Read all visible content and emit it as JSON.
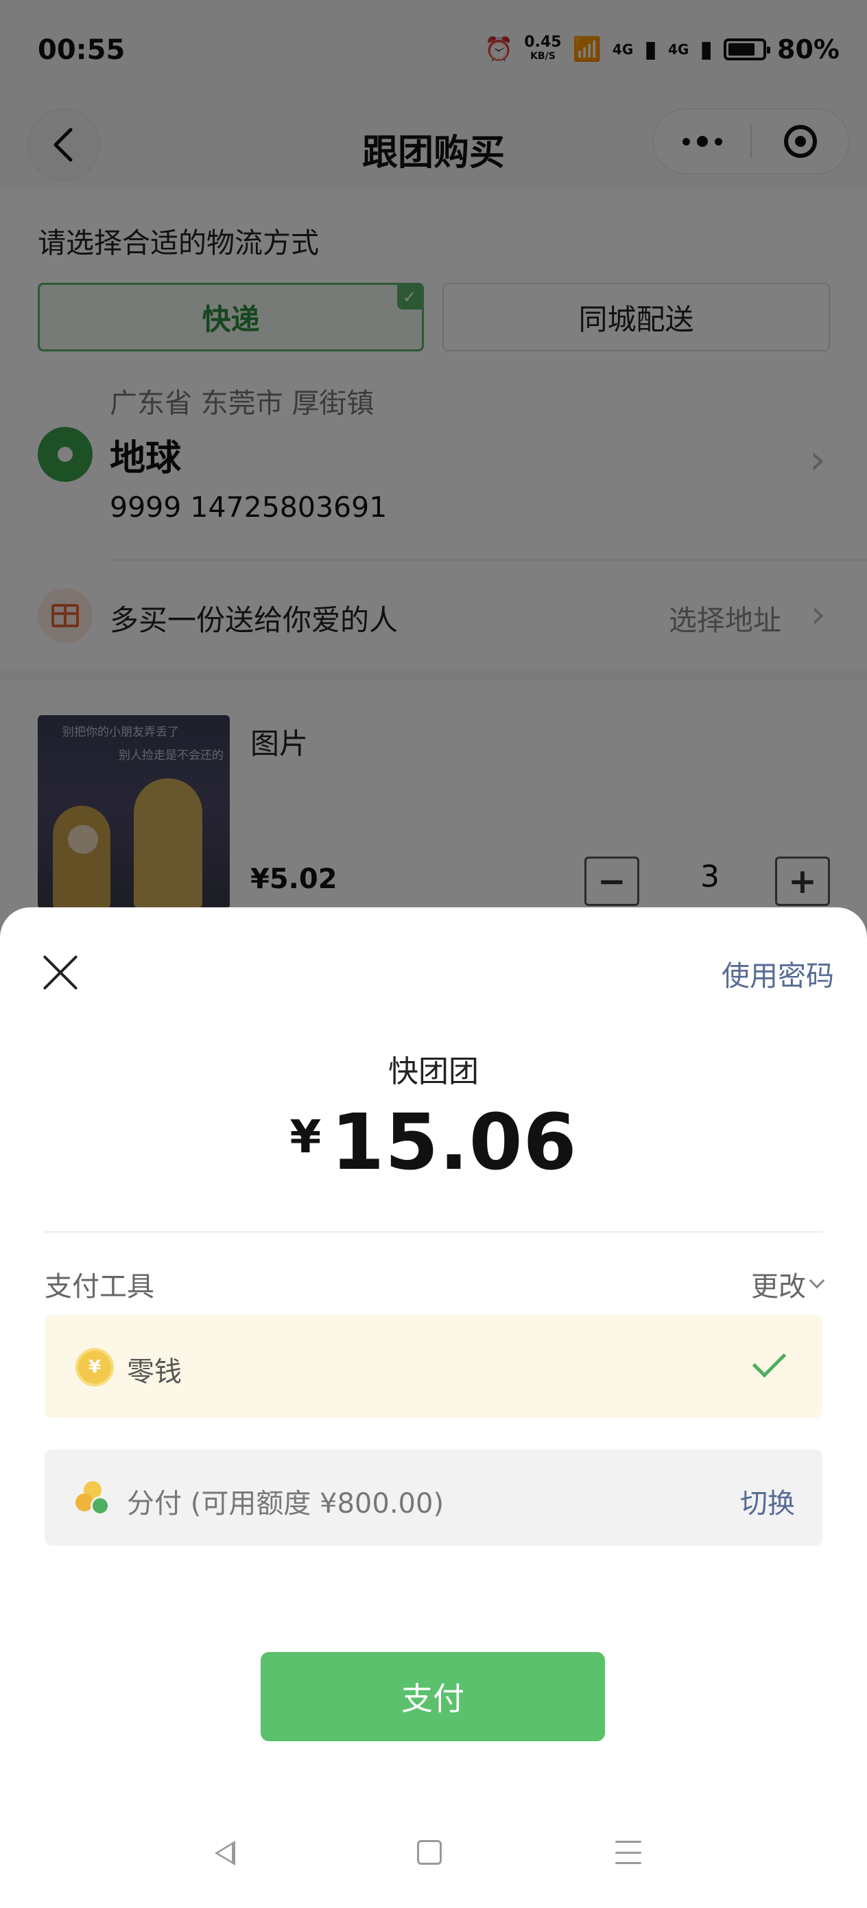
{
  "status_bar": {
    "time": "00:55",
    "net_speed": "0.45",
    "net_unit": "KB/S",
    "network_labels": [
      "4G",
      "4G"
    ],
    "battery_percent": "80%",
    "battery_level": 0.8
  },
  "nav": {
    "title": "跟团购买"
  },
  "logistics": {
    "label": "请选择合适的物流方式",
    "options": [
      {
        "label": "快递",
        "selected": true
      },
      {
        "label": "同城配送",
        "selected": false
      }
    ]
  },
  "address": {
    "region": "广东省 东莞市 厚街镇",
    "name": "地球",
    "phone": "9999 14725803691"
  },
  "gift": {
    "text": "多买一份送给你爱的人",
    "select_label": "选择地址"
  },
  "product": {
    "image_caption_1": "别把你的小朋友弄丢了",
    "image_caption_2": "别人捡走是不会还的",
    "name": "图片",
    "price": "¥5.02",
    "quantity": "3"
  },
  "payment": {
    "use_password_label": "使用密码",
    "merchant": "快团团",
    "currency_symbol": "¥",
    "amount": "15.06",
    "tool_label": "支付工具",
    "change_label": "更改",
    "wallet_label": "零钱",
    "wallet_coin_glyph": "¥",
    "fenfu_label": "分付 (可用额度 ¥800.00)",
    "switch_label": "切换",
    "pay_button_label": "支付"
  },
  "colors": {
    "accent_green": "#5bc16c",
    "link_blue": "#576b95",
    "wallet_bg": "#fdf7e7"
  }
}
